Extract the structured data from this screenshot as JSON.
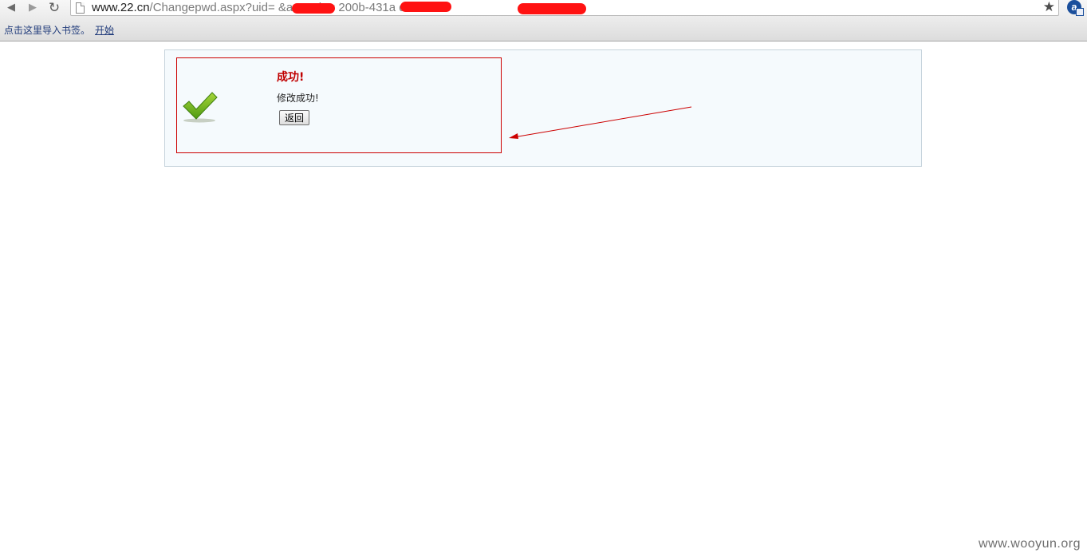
{
  "browser": {
    "url_host": "www.22.cn",
    "url_path": "/Changepwd.aspx?uid=        &actcode=              200b-431a             d577485",
    "icons": [
      "back-icon",
      "forward-icon",
      "reload-icon",
      "page-icon",
      "star-icon",
      "extension-icon"
    ],
    "extension_label": "a"
  },
  "bookmarks_bar": {
    "hint": "点击这里导入书签。",
    "start_link": "开始"
  },
  "result": {
    "title": "成功!",
    "message": "修改成功!",
    "back_button": "返回"
  },
  "annotation": {
    "color": "#cc0000"
  },
  "watermark": "www.wooyun.org"
}
